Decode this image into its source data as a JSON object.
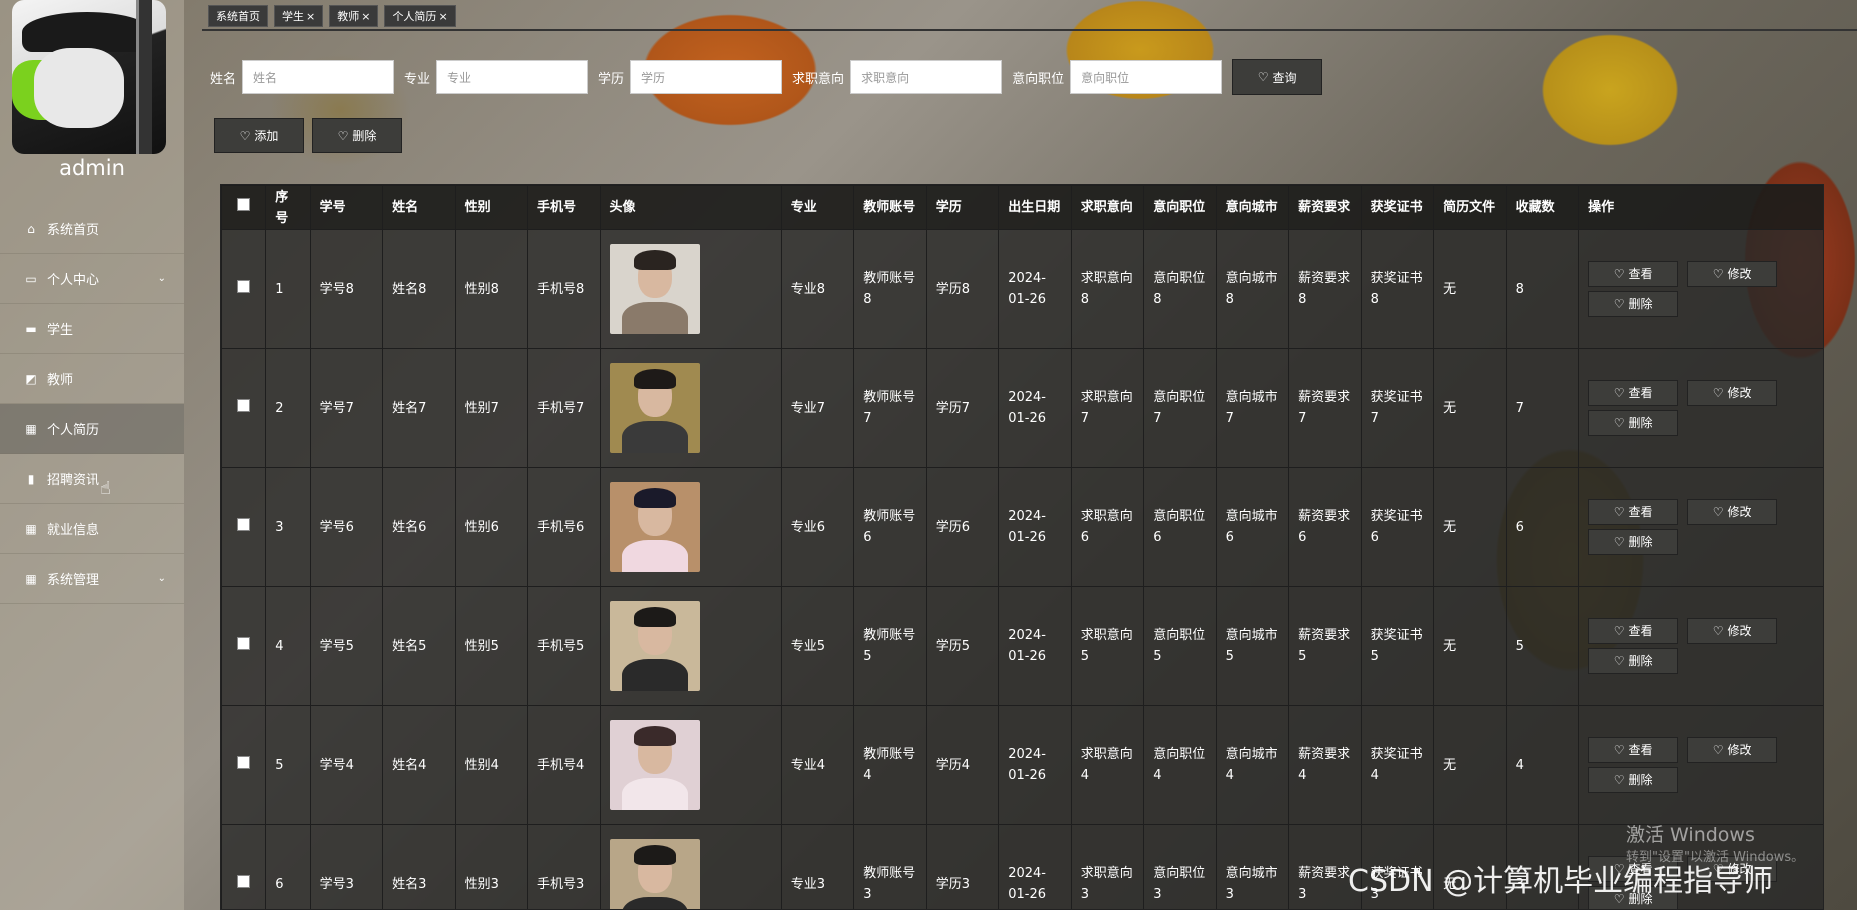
{
  "user": {
    "name": "admin"
  },
  "sidebar": {
    "items": [
      {
        "label": "系统首页",
        "icon": "home-icon"
      },
      {
        "label": "个人中心",
        "icon": "user-card-icon",
        "expandable": true
      },
      {
        "label": "学生",
        "icon": "monitor-icon"
      },
      {
        "label": "教师",
        "icon": "chart-line-icon"
      },
      {
        "label": "个人简历",
        "icon": "grid-icon",
        "active": true
      },
      {
        "label": "招聘资讯",
        "icon": "bar-chart-icon"
      },
      {
        "label": "就业信息",
        "icon": "apps-icon"
      },
      {
        "label": "系统管理",
        "icon": "apps-icon",
        "expandable": true
      }
    ]
  },
  "tabs": [
    {
      "label": "系统首页",
      "closable": false
    },
    {
      "label": "学生",
      "closable": true
    },
    {
      "label": "教师",
      "closable": true
    },
    {
      "label": "个人简历",
      "closable": true
    }
  ],
  "tab_close_glyph": "×",
  "search": {
    "fields": [
      {
        "label": "姓名",
        "placeholder": "姓名"
      },
      {
        "label": "专业",
        "placeholder": "专业"
      },
      {
        "label": "学历",
        "placeholder": "学历"
      },
      {
        "label": "求职意向",
        "placeholder": "求职意向"
      },
      {
        "label": "意向职位",
        "placeholder": "意向职位"
      }
    ],
    "query_label": "查询"
  },
  "actions": {
    "add_label": "添加",
    "delete_label": "删除"
  },
  "table": {
    "headers": [
      "序号",
      "学号",
      "姓名",
      "性别",
      "手机号",
      "头像",
      "专业",
      "教师账号",
      "学历",
      "出生日期",
      "求职意向",
      "意向职位",
      "意向城市",
      "薪资要求",
      "获奖证书",
      "简历文件",
      "收藏数",
      "操作"
    ],
    "rows": [
      {
        "idx": "1",
        "sno": "学号8",
        "name": "姓名8",
        "gender": "性别8",
        "phone": "手机号8",
        "major": "专业8",
        "teacher": "教师账号8",
        "edu": "学历8",
        "birth": "2024-01-26",
        "intent": "求职意向8",
        "position": "意向职位8",
        "city": "意向城市8",
        "salary": "薪资要求8",
        "cert": "获奖证书8",
        "file": "无",
        "fav": "8"
      },
      {
        "idx": "2",
        "sno": "学号7",
        "name": "姓名7",
        "gender": "性别7",
        "phone": "手机号7",
        "major": "专业7",
        "teacher": "教师账号7",
        "edu": "学历7",
        "birth": "2024-01-26",
        "intent": "求职意向7",
        "position": "意向职位7",
        "city": "意向城市7",
        "salary": "薪资要求7",
        "cert": "获奖证书7",
        "file": "无",
        "fav": "7"
      },
      {
        "idx": "3",
        "sno": "学号6",
        "name": "姓名6",
        "gender": "性别6",
        "phone": "手机号6",
        "major": "专业6",
        "teacher": "教师账号6",
        "edu": "学历6",
        "birth": "2024-01-26",
        "intent": "求职意向6",
        "position": "意向职位6",
        "city": "意向城市6",
        "salary": "薪资要求6",
        "cert": "获奖证书6",
        "file": "无",
        "fav": "6"
      },
      {
        "idx": "4",
        "sno": "学号5",
        "name": "姓名5",
        "gender": "性别5",
        "phone": "手机号5",
        "major": "专业5",
        "teacher": "教师账号5",
        "edu": "学历5",
        "birth": "2024-01-26",
        "intent": "求职意向5",
        "position": "意向职位5",
        "city": "意向城市5",
        "salary": "薪资要求5",
        "cert": "获奖证书5",
        "file": "无",
        "fav": "5"
      },
      {
        "idx": "5",
        "sno": "学号4",
        "name": "姓名4",
        "gender": "性别4",
        "phone": "手机号4",
        "major": "专业4",
        "teacher": "教师账号4",
        "edu": "学历4",
        "birth": "2024-01-26",
        "intent": "求职意向4",
        "position": "意向职位4",
        "city": "意向城市4",
        "salary": "薪资要求4",
        "cert": "获奖证书4",
        "file": "无",
        "fav": "4"
      },
      {
        "idx": "6",
        "sno": "学号3",
        "name": "姓名3",
        "gender": "性别3",
        "phone": "手机号3",
        "major": "专业3",
        "teacher": "教师账号3",
        "edu": "学历3",
        "birth": "2024-01-26",
        "intent": "求职意向3",
        "position": "意向职位3",
        "city": "意向城市3",
        "salary": "薪资要求3",
        "cert": "获奖证书3",
        "file": "无",
        "fav": "3"
      }
    ],
    "op_labels": {
      "view": "查看",
      "edit": "修改",
      "delete": "删除"
    }
  },
  "watermarks": {
    "activate_title": "激活 Windows",
    "activate_sub": "转到\"设置\"以激活 Windows。",
    "csdn": "CSDN @计算机毕业编程指导师"
  },
  "colors": {
    "button_bg": "#3d3d3a",
    "header_bg": "#1c1c1a",
    "row_bg": "#2a2a28"
  }
}
